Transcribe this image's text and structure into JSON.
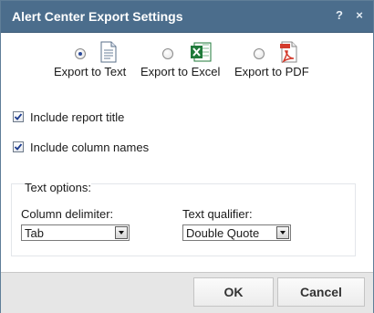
{
  "dialog": {
    "title": "Alert Center Export Settings",
    "help_label": "?",
    "close_label": "×"
  },
  "formats": [
    {
      "label": "Export to Text",
      "selected": true,
      "icon": "text-document-icon"
    },
    {
      "label": "Export to Excel",
      "selected": false,
      "icon": "excel-icon"
    },
    {
      "label": "Export to PDF",
      "selected": false,
      "icon": "pdf-icon"
    }
  ],
  "options": {
    "include_title": {
      "label": "Include report title",
      "checked": true
    },
    "include_columns": {
      "label": "Include column names",
      "checked": true
    }
  },
  "text_options": {
    "title": "Text options:",
    "delimiter_label": "Column delimiter:",
    "delimiter_value": "Tab",
    "qualifier_label": "Text qualifier:",
    "qualifier_value": "Double Quote"
  },
  "buttons": {
    "ok": "OK",
    "cancel": "Cancel"
  },
  "colors": {
    "titlebar": "#4b6d8c",
    "excel_green": "#1f7a3a",
    "pdf_red": "#d33a2c"
  }
}
